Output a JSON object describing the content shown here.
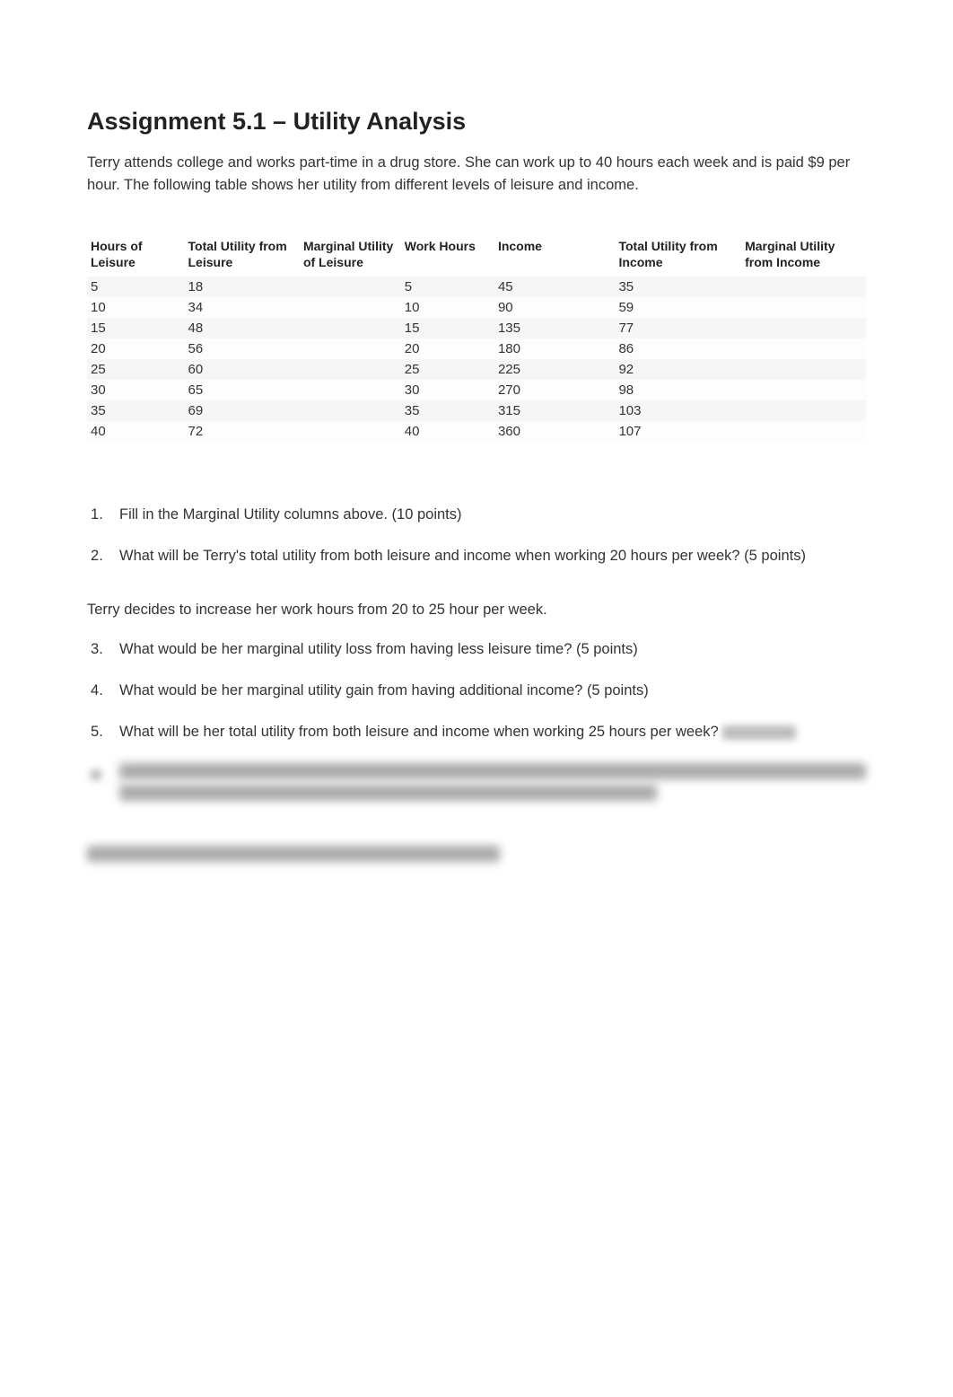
{
  "title": "Assignment 5.1 – Utility Analysis",
  "intro": "Terry attends college and works part-time in a drug store. She can work up to 40 hours each week and is paid $9 per hour. The following table shows her utility from different levels of leisure and income.",
  "table": {
    "headers": {
      "c1": "Hours of Leisure",
      "c2": "Total Utility from Leisure",
      "c3": "Marginal Utility of Leisure",
      "c4": "Work Hours",
      "c5": "Income",
      "c6": "Total Utility from Income",
      "c7": "Marginal Utility from Income"
    },
    "rows": [
      {
        "c1": "5",
        "c2": "18",
        "c3": "",
        "c4": "5",
        "c5": "45",
        "c6": "35",
        "c7": ""
      },
      {
        "c1": "10",
        "c2": "34",
        "c3": "",
        "c4": "10",
        "c5": "90",
        "c6": "59",
        "c7": ""
      },
      {
        "c1": "15",
        "c2": "48",
        "c3": "",
        "c4": "15",
        "c5": "135",
        "c6": "77",
        "c7": ""
      },
      {
        "c1": "20",
        "c2": "56",
        "c3": "",
        "c4": "20",
        "c5": "180",
        "c6": "86",
        "c7": ""
      },
      {
        "c1": "25",
        "c2": "60",
        "c3": "",
        "c4": "25",
        "c5": "225",
        "c6": "92",
        "c7": ""
      },
      {
        "c1": "30",
        "c2": "65",
        "c3": "",
        "c4": "30",
        "c5": "270",
        "c6": "98",
        "c7": ""
      },
      {
        "c1": "35",
        "c2": "69",
        "c3": "",
        "c4": "35",
        "c5": "315",
        "c6": "103",
        "c7": ""
      },
      {
        "c1": "40",
        "c2": "72",
        "c3": "",
        "c4": "40",
        "c5": "360",
        "c6": "107",
        "c7": ""
      }
    ]
  },
  "questions": {
    "q1": "Fill in the Marginal Utility columns above. (10 points)",
    "q2": "What will be Terry's total utility from both leisure and income when working 20 hours per week? (5 points)",
    "para1": "Terry decides to increase her work hours from 20 to 25 hour per week.",
    "q3": "What would be her marginal utility loss from having less leisure time? (5 points)",
    "q4": "What would be her marginal utility gain from having additional income? (5 points)",
    "q5": "What will be her total utility from both leisure and income when working 25 hours per week?"
  }
}
